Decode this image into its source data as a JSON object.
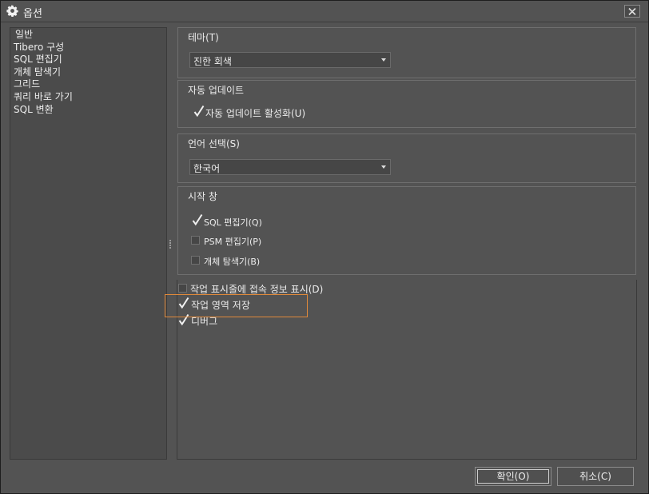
{
  "window": {
    "title": "옵션",
    "title_icon": "gear-icon",
    "close_icon": "close-icon"
  },
  "sidebar": {
    "items": [
      {
        "label": "일반"
      },
      {
        "label": "Tibero 구성"
      },
      {
        "label": "SQL 편집기"
      },
      {
        "label": "개체 탐색기"
      },
      {
        "label": "그리드"
      },
      {
        "label": "쿼리 바로 가기"
      },
      {
        "label": "SQL 변환"
      }
    ]
  },
  "theme": {
    "title": "테마(T)",
    "selected": "진한 회색"
  },
  "auto_update": {
    "title": "자동 업데이트",
    "enable_label": "자동 업데이트 활성화(U)",
    "enable_checked": true
  },
  "language": {
    "title": "언어 선택(S)",
    "selected": "한국어"
  },
  "start_window": {
    "title": "시작 창",
    "options": [
      {
        "label": "SQL 편집기(Q)",
        "checked": true
      },
      {
        "label": "PSM 편집기(P)",
        "checked": false
      },
      {
        "label": "개체 탐색기(B)",
        "checked": false
      }
    ]
  },
  "misc": {
    "show_connection_label": "작업 표시줄에 접속 정보 표시(D)",
    "show_connection_checked": false,
    "save_workspace_label": "작업 영역 저장",
    "save_workspace_checked": true,
    "debug_label": "디버그",
    "debug_checked": true
  },
  "buttons": {
    "ok": "확인(O)",
    "cancel": "취소(C)"
  },
  "colors": {
    "highlight": "#e0893a",
    "background": "#535353"
  }
}
